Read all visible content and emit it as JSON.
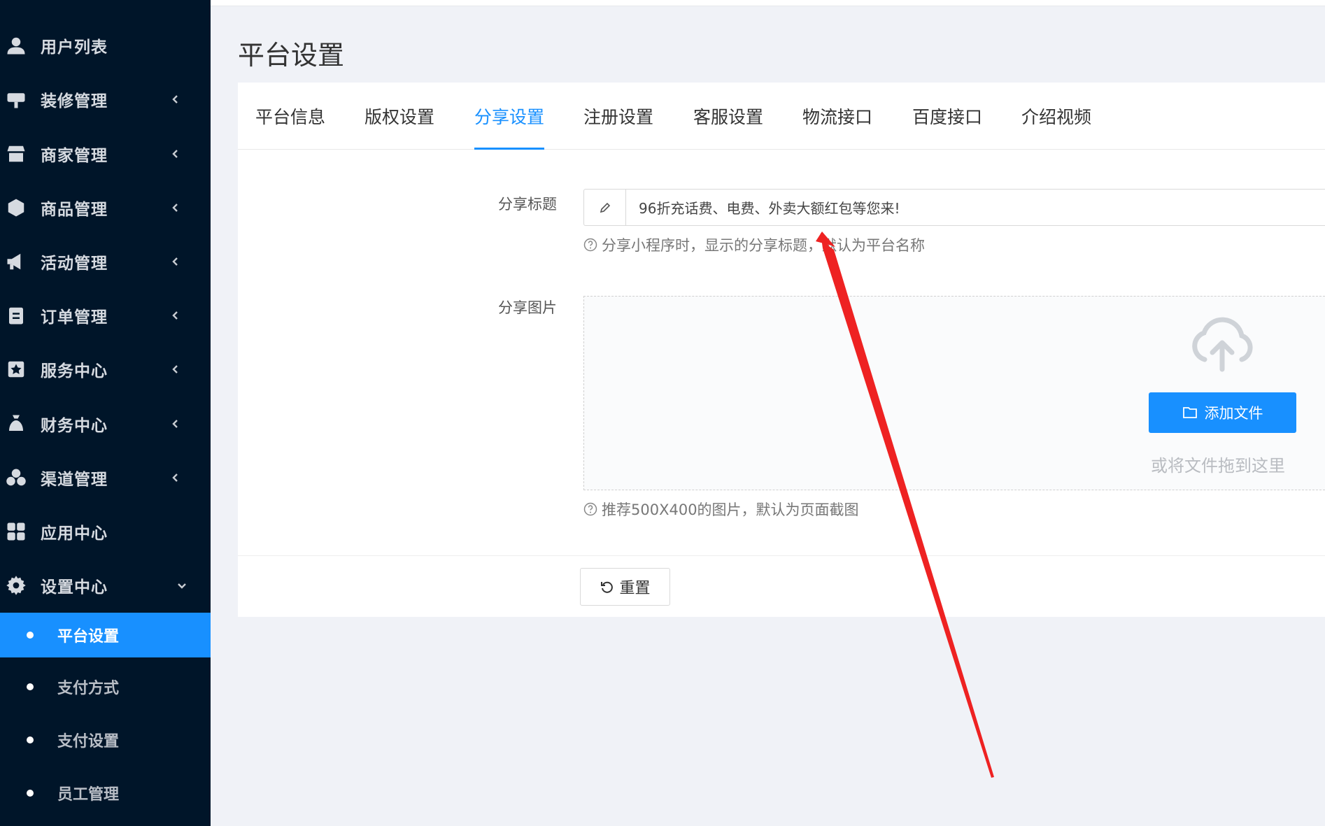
{
  "sidebar": {
    "items": [
      {
        "label": "用户列表",
        "icon": "user-icon"
      },
      {
        "label": "装修管理",
        "icon": "brush-icon"
      },
      {
        "label": "商家管理",
        "icon": "store-icon"
      },
      {
        "label": "商品管理",
        "icon": "box-icon"
      },
      {
        "label": "活动管理",
        "icon": "megaphone-icon"
      },
      {
        "label": "订单管理",
        "icon": "clipboard-icon"
      },
      {
        "label": "服务中心",
        "icon": "bookmark-star-icon"
      },
      {
        "label": "财务中心",
        "icon": "money-bag-icon"
      },
      {
        "label": "渠道管理",
        "icon": "cubes-icon"
      },
      {
        "label": "应用中心",
        "icon": "apps-grid-icon"
      },
      {
        "label": "设置中心",
        "icon": "gear-icon"
      }
    ],
    "sub_items": [
      {
        "label": "平台设置",
        "active": true
      },
      {
        "label": "支付方式",
        "active": false
      },
      {
        "label": "支付设置",
        "active": false
      },
      {
        "label": "员工管理",
        "active": false
      }
    ]
  },
  "page": {
    "title": "平台设置"
  },
  "tabs": [
    "平台信息",
    "版权设置",
    "分享设置",
    "注册设置",
    "客服设置",
    "物流接口",
    "百度接口",
    "介绍视频"
  ],
  "active_tab": "分享设置",
  "form": {
    "share_title": {
      "label": "分享标题",
      "value": "96折充话费、电费、外卖大额红包等您来!",
      "hint": "分享小程序时，显示的分享标题，默认为平台名称"
    },
    "share_image": {
      "label": "分享图片",
      "add_button": "添加文件",
      "drag_text": "或将文件拖到这里",
      "hint": "推荐500X400的图片，默认为页面截图"
    },
    "reset_button": "重置"
  },
  "colors": {
    "sidebar_bg": "#001529",
    "accent": "#1890ff",
    "annotation_arrow": "#ee2222"
  }
}
